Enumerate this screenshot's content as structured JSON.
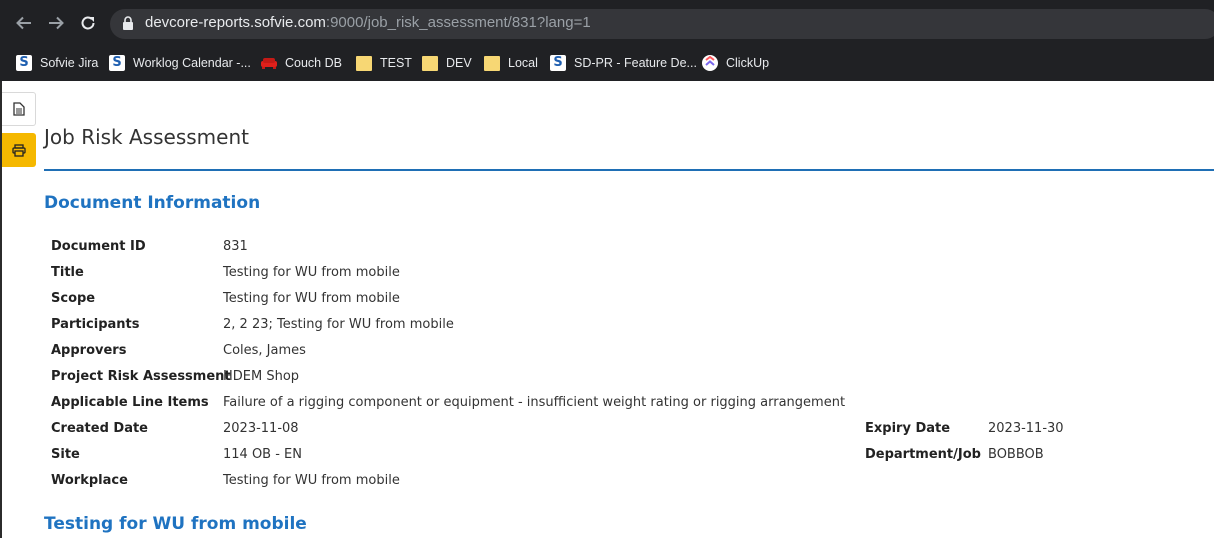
{
  "browser": {
    "url_host": "devcore-reports.sofvie.com",
    "url_rest": ":9000/job_risk_assessment/831?lang=1",
    "bookmarks": [
      {
        "label": "Sofvie Jira",
        "icon": "sofvie-icon"
      },
      {
        "label": "Worklog Calendar -...",
        "icon": "sofvie-icon"
      },
      {
        "label": "Couch DB",
        "icon": "couch-icon"
      },
      {
        "label": "TEST",
        "icon": "folder-icon"
      },
      {
        "label": "DEV",
        "icon": "folder-icon"
      },
      {
        "label": "Local",
        "icon": "folder-icon"
      },
      {
        "label": "SD-PR - Feature De...",
        "icon": "sofvie-icon"
      },
      {
        "label": "ClickUp",
        "icon": "clickup-icon"
      }
    ]
  },
  "page": {
    "title": "Job Risk Assessment",
    "accent_color": "#1f73c1",
    "sidebar": {
      "print_color": "#f5b800"
    }
  },
  "document_info": {
    "heading": "Document Information",
    "fields": [
      {
        "label": "Document ID",
        "value": "831"
      },
      {
        "label": "Title",
        "value": "Testing for WU from mobile"
      },
      {
        "label": "Scope",
        "value": "Testing for WU from mobile"
      },
      {
        "label": "Participants",
        "value": "2, 2 23; Testing for WU from mobile"
      },
      {
        "label": "Approvers",
        "value": "Coles, James"
      },
      {
        "label": "Project Risk Assessment",
        "value": "HDEM Shop"
      },
      {
        "label": "Applicable Line Items",
        "value": "Failure of a rigging component or equipment - insufficient weight rating or rigging arrangement"
      },
      {
        "label": "Created Date",
        "value": "2023-11-08"
      },
      {
        "label": "Site",
        "value": "114 OB - EN"
      },
      {
        "label": "Workplace",
        "value": "Testing for WU from mobile"
      }
    ],
    "right_fields": [
      {
        "label": "Expiry Date",
        "value": "2023-11-30"
      },
      {
        "label": "Department/Job",
        "value": "BOBBOB"
      }
    ]
  },
  "next_section": {
    "heading": "Testing for WU from mobile"
  }
}
